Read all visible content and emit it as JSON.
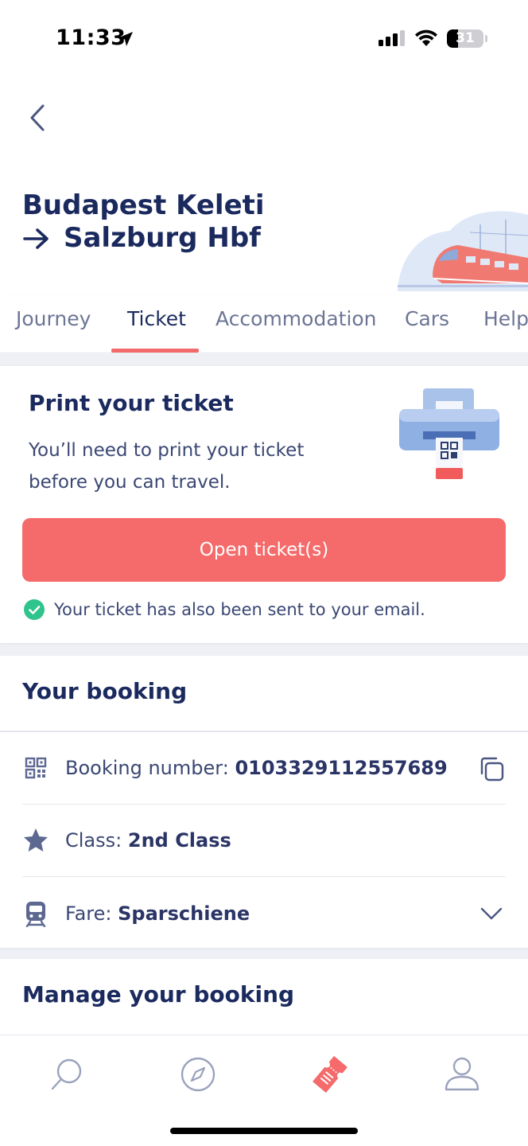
{
  "status_bar": {
    "time": "11:33",
    "battery": "31",
    "battery_level": 0.31
  },
  "header": {
    "title_line1": "Budapest Keleti",
    "title_line2": "Salzburg Hbf"
  },
  "tabs": [
    {
      "label": "Journey",
      "active": false
    },
    {
      "label": "Ticket",
      "active": true
    },
    {
      "label": "Accommodation",
      "active": false
    },
    {
      "label": "Cars",
      "active": false
    },
    {
      "label": "Help",
      "active": false
    }
  ],
  "print_card": {
    "title": "Print your ticket",
    "description": "You’ll need to print your ticket before you can travel.",
    "button_label": "Open ticket(s)",
    "email_note": "Your ticket has also been sent to your email."
  },
  "booking": {
    "title": "Your booking",
    "booking_number_label": "Booking number:",
    "booking_number": "0103329112557689",
    "class_label": "Class:",
    "class_value": "2nd Class",
    "fare_label": "Fare:",
    "fare_value": "Sparschiene"
  },
  "manage": {
    "title": "Manage your booking"
  },
  "nav": {
    "items": [
      {
        "icon": "search-icon",
        "active": false
      },
      {
        "icon": "compass-icon",
        "active": false
      },
      {
        "icon": "ticket-icon",
        "active": true
      },
      {
        "icon": "profile-icon",
        "active": false
      }
    ]
  },
  "colors": {
    "accent": "#f56a6a",
    "navy": "#1b2a5e",
    "success": "#2fc48d"
  }
}
